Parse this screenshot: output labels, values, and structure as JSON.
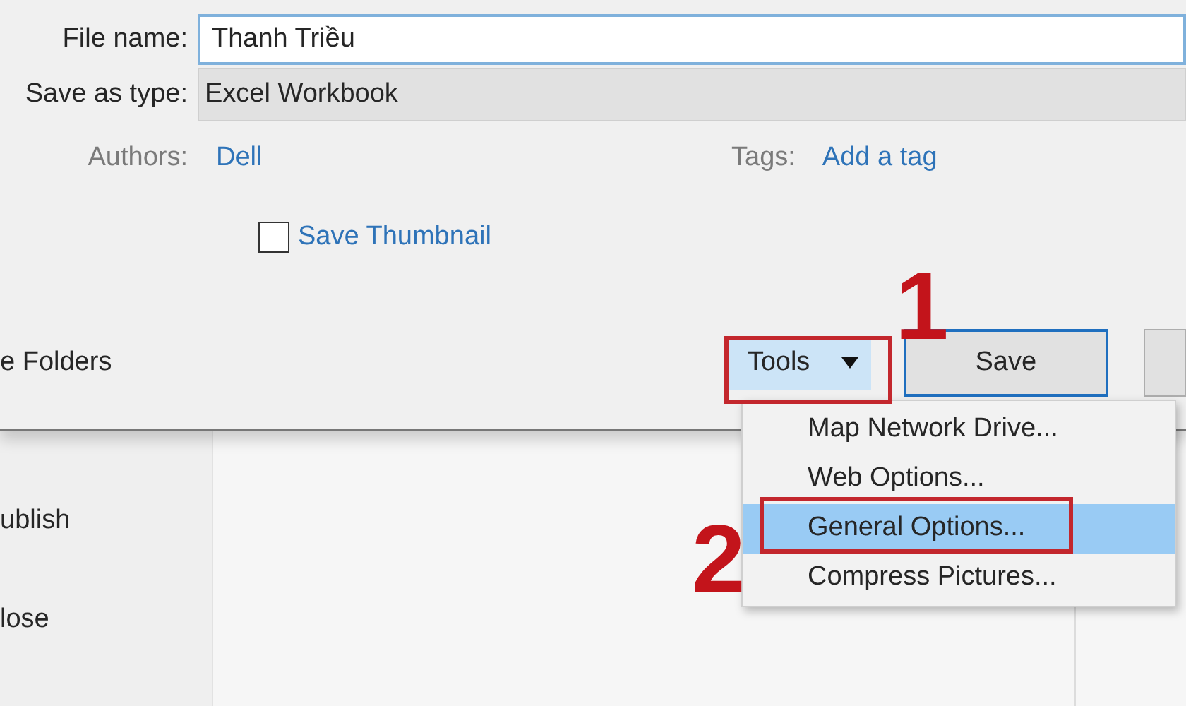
{
  "dialog": {
    "file_name": {
      "label": "File name:",
      "value": "Thanh Triều"
    },
    "save_as_type": {
      "label": "Save as type:",
      "value": "Excel Workbook"
    },
    "authors": {
      "label": "Authors:",
      "value": "Dell"
    },
    "tags": {
      "label": "Tags:",
      "value": "Add a tag"
    },
    "save_thumbnail": {
      "label": "Save Thumbnail",
      "checked": false
    },
    "hide_folders": "e Folders",
    "tools_button": "Tools",
    "save_button": "Save"
  },
  "tools_menu": [
    {
      "label": "Map Network Drive...",
      "selected": false
    },
    {
      "label": "Web Options...",
      "selected": false
    },
    {
      "label": "General Options...",
      "selected": true
    },
    {
      "label": "Compress Pictures...",
      "selected": false
    }
  ],
  "sidebar": [
    "ublish",
    "lose"
  ],
  "annotations": [
    {
      "label": "1"
    },
    {
      "label": "2"
    }
  ]
}
